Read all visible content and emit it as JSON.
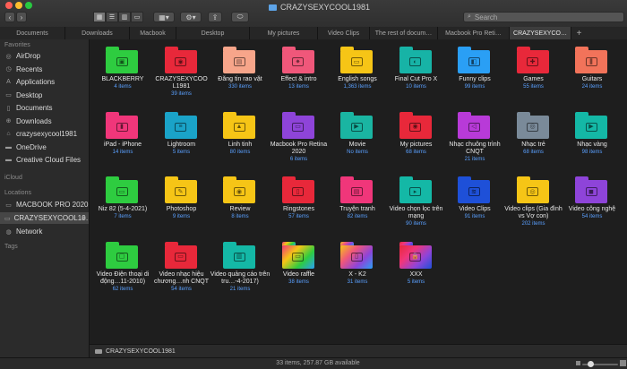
{
  "window": {
    "title": "CRAZYSEXYCOOL1981"
  },
  "toolbar": {
    "back_icon": "chevron-left",
    "forward_icon": "chevron-right",
    "search_placeholder": "Search"
  },
  "tabs": [
    {
      "label": "Documents",
      "active": false
    },
    {
      "label": "Downloads",
      "active": false
    },
    {
      "label": "Macbook",
      "active": false
    },
    {
      "label": "Desktop",
      "active": false
    },
    {
      "label": "My pictures",
      "active": false
    },
    {
      "label": "Video Clips",
      "active": false
    },
    {
      "label": "The rest of docum…",
      "active": false
    },
    {
      "label": "Macbook Pro Reti…",
      "active": false
    },
    {
      "label": "CRAZYSEXYCO…",
      "active": true
    }
  ],
  "sidebar": {
    "favorites_header": "Favorites",
    "favorites": [
      {
        "label": "AirDrop",
        "icon": "airdrop-icon"
      },
      {
        "label": "Recents",
        "icon": "clock-icon"
      },
      {
        "label": "Applications",
        "icon": "applications-icon"
      },
      {
        "label": "Desktop",
        "icon": "desktop-icon"
      },
      {
        "label": "Documents",
        "icon": "document-icon"
      },
      {
        "label": "Downloads",
        "icon": "download-icon"
      },
      {
        "label": "crazysexycool1981",
        "icon": "home-icon"
      },
      {
        "label": "OneDrive",
        "icon": "folder-icon"
      },
      {
        "label": "Creative Cloud Files",
        "icon": "folder-icon"
      }
    ],
    "icloud_header": "iCloud",
    "locations_header": "Locations",
    "locations": [
      {
        "label": "MACBOOK PRO 2020",
        "icon": "disk-icon",
        "selected": false
      },
      {
        "label": "CRAZYSEXYCOOL19…",
        "icon": "disk-icon",
        "selected": true
      },
      {
        "label": "Network",
        "icon": "globe-icon",
        "selected": false
      }
    ],
    "tags_header": "Tags"
  },
  "folders": [
    {
      "name": "BLACKBERRY",
      "count": "4 items",
      "color": "#2ecc40",
      "glyph": "▣",
      "icon": "blackberry-icon"
    },
    {
      "name": "CRAZYSEXYCOO L1981",
      "count": "39 items",
      "color": "#e8283a",
      "glyph": "◉",
      "icon": "user-icon"
    },
    {
      "name": "Đăng tin rao vặt",
      "count": "330 items",
      "color": "#f7a58a",
      "glyph": "▤",
      "icon": "newspaper-icon"
    },
    {
      "name": "Effect & intro",
      "count": "13 items",
      "color": "#f0577a",
      "glyph": "✷",
      "icon": "sparkle-icon"
    },
    {
      "name": "English songs",
      "count": "1,363 items",
      "color": "#f6c516",
      "glyph": "▭",
      "icon": "music-icon"
    },
    {
      "name": "Final Cut Pro X",
      "count": "10 items",
      "color": "#17b3a6",
      "glyph": "◐",
      "icon": "palette-icon"
    },
    {
      "name": "Funny clips",
      "count": "99 items",
      "color": "#2a9ff5",
      "glyph": "◧",
      "icon": "film-icon"
    },
    {
      "name": "Games",
      "count": "55 items",
      "color": "#e8283a",
      "glyph": "✚",
      "icon": "gamepad-icon"
    },
    {
      "name": "Guitars",
      "count": "24 items",
      "color": "#f2735a",
      "glyph": "⫼",
      "icon": "guitar-icon"
    },
    {
      "name": "iPad - iPhone",
      "count": "14 items",
      "color": "#f0367a",
      "glyph": "▮",
      "icon": "tablet-icon"
    },
    {
      "name": "Lightroom",
      "count": "5 items",
      "color": "#1aa3c8",
      "glyph": "≡",
      "icon": "sliders-icon"
    },
    {
      "name": "Linh tinh",
      "count": "80 items",
      "color": "#f6c516",
      "glyph": "▲",
      "icon": "bell-icon"
    },
    {
      "name": "Macbook Pro Retina 2020",
      "count": "6 items",
      "color": "#8e44d9",
      "glyph": "▭",
      "icon": "laptop-icon"
    },
    {
      "name": "Movie",
      "count": "No items",
      "color": "#1ab5a2",
      "glyph": "▶",
      "icon": "movie-icon"
    },
    {
      "name": "My pictures",
      "count": "68 items",
      "color": "#e8283a",
      "glyph": "◉",
      "icon": "camera-icon"
    },
    {
      "name": "Nhạc chuông trình CNQT",
      "count": "21 items",
      "color": "#b83ad8",
      "glyph": "◁",
      "icon": "speaker-icon"
    },
    {
      "name": "Nhạc trẻ",
      "count": "68 items",
      "color": "#7a8a99",
      "glyph": "◎",
      "icon": "speaker-box-icon"
    },
    {
      "name": "Nhạc vàng",
      "count": "98 items",
      "color": "#14b8a6",
      "glyph": "▶",
      "icon": "play-icon"
    },
    {
      "name": "Niz 82 (5-4-2021)",
      "count": "7 items",
      "color": "#2ecc40",
      "glyph": "▭",
      "icon": "card-icon"
    },
    {
      "name": "Photoshop",
      "count": "9 items",
      "color": "#f6c516",
      "glyph": "✎",
      "icon": "wand-icon"
    },
    {
      "name": "Review",
      "count": "8 items",
      "color": "#f6c516",
      "glyph": "◉",
      "icon": "eye-icon"
    },
    {
      "name": "Ringstones",
      "count": "57 items",
      "color": "#e8283a",
      "glyph": "▯",
      "icon": "phone-vibrate-icon"
    },
    {
      "name": "Truyện tranh",
      "count": "82 items",
      "color": "#f0367a",
      "glyph": "▤",
      "icon": "book-icon"
    },
    {
      "name": "Video chọn lọc trên mạng",
      "count": "90 items",
      "color": "#14b8a6",
      "glyph": "▸",
      "icon": "fast-forward-icon"
    },
    {
      "name": "Video Clips",
      "count": "91 items",
      "color": "#1e50d8",
      "glyph": "≋",
      "icon": "waveform-icon"
    },
    {
      "name": "Video clips (Gia đình vs Vợ con)",
      "count": "202 items",
      "color": "#f6c516",
      "glyph": "◎",
      "icon": "film-reel-icon"
    },
    {
      "name": "Video công nghệ",
      "count": "54 items",
      "color": "#8e44d9",
      "glyph": "◼",
      "icon": "video-camera-icon"
    },
    {
      "name": "Video Điện thoại di động…11-2010)",
      "count": "62 items",
      "color": "#2ecc40",
      "glyph": "▢",
      "icon": "mobile-icon"
    },
    {
      "name": "Video nhạc hiệu chương…nh CNQT",
      "count": "54 items",
      "color": "#e8283a",
      "glyph": "▭",
      "icon": "tv-icon"
    },
    {
      "name": "Video quảng cáo trên tru…-4-2017)",
      "count": "21 items",
      "color": "#14b8a6",
      "glyph": "▥",
      "icon": "columns-icon"
    },
    {
      "name": "Video raffle",
      "count": "38 items",
      "color": "#multi",
      "glyph": "▭",
      "icon": "screens-icon"
    },
    {
      "name": "X - K2",
      "count": "31 items",
      "color": "#multi",
      "glyph": "▯",
      "icon": "phone-icon"
    },
    {
      "name": "XXX",
      "count": "5 items",
      "color": "#multi",
      "glyph": "🔒",
      "icon": "lock-icon"
    }
  ],
  "pathbar": {
    "label": "CRAZYSEXYCOOL1981"
  },
  "status": {
    "text": "33 items, 257.87 GB available"
  }
}
